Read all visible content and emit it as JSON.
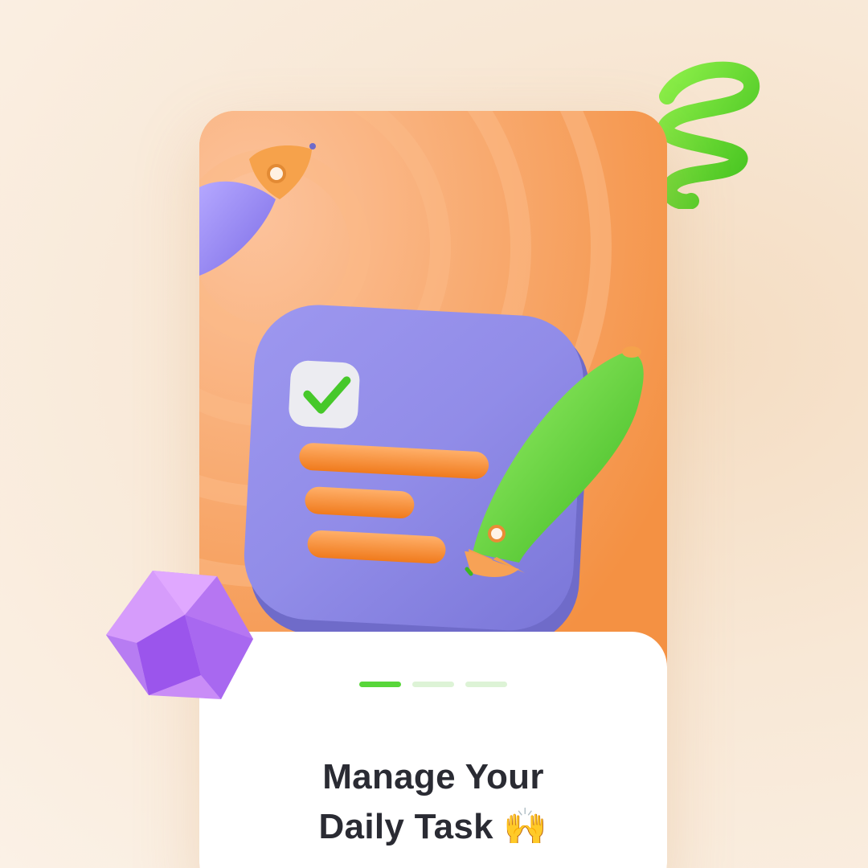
{
  "onboarding": {
    "title_line_1": "Manage Your",
    "title_line_2": "Daily Task 🙌",
    "pager": {
      "total_pages": 3,
      "active_page": 1
    }
  },
  "colors": {
    "background": "#fbf1e6",
    "hero_orange": "#f8a266",
    "sheet": "#ffffff",
    "accent_green": "#58d63a",
    "checklist_purple": "#8d8ae6",
    "task_bar_orange": "#f58a2a",
    "title_text": "#2a2b33"
  },
  "icons": [
    "checklist-3d-illustration",
    "checkmark-icon",
    "green-pen-icon",
    "purple-pen-icon",
    "purple-gem-icon",
    "green-spiral-icon"
  ]
}
